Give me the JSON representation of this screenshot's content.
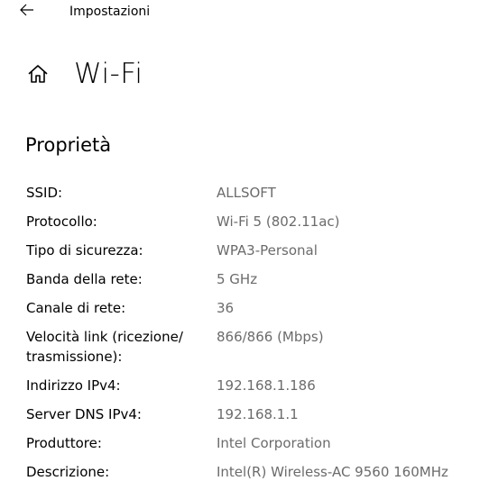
{
  "window": {
    "app_title": "Impostazioni",
    "back_icon": "back-arrow-icon"
  },
  "header": {
    "home_icon": "home-icon",
    "title": "Wi-Fi"
  },
  "section": {
    "title": "Proprietà"
  },
  "properties": [
    {
      "label": "SSID:",
      "value": "ALLSOFT"
    },
    {
      "label": "Protocollo:",
      "value": "Wi-Fi 5 (802.11ac)"
    },
    {
      "label": "Tipo di sicurezza:",
      "value": "WPA3-Personal"
    },
    {
      "label": "Banda della rete:",
      "value": "5 GHz"
    },
    {
      "label": "Canale di rete:",
      "value": "36"
    },
    {
      "label": "Velocità link (ricezione/ trasmissione):",
      "value": "866/866 (Mbps)"
    },
    {
      "label": "Indirizzo IPv4:",
      "value": "192.168.1.186"
    },
    {
      "label": "Server DNS IPv4:",
      "value": "192.168.1.1"
    },
    {
      "label": "Produttore:",
      "value": "Intel Corporation"
    },
    {
      "label": "Descrizione:",
      "value": "Intel(R) Wireless-AC 9560 160MHz"
    }
  ]
}
